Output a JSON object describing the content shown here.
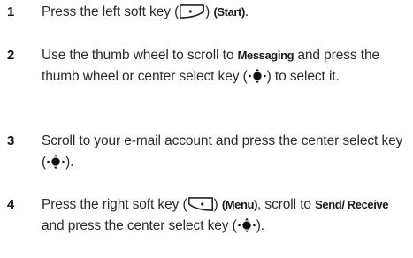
{
  "steps": [
    {
      "number": "1",
      "t1": "Press the left soft key (",
      "t2": ") ",
      "kw1": "(Start)",
      "t3": "."
    },
    {
      "number": "2",
      "t1": "Use the thumb wheel to scroll to ",
      "kw1": "Messaging",
      "t2": " and press the thumb wheel or center select key (",
      "t3": ") to select it."
    },
    {
      "number": "3",
      "t1": "Scroll to your e-mail account and press the center select key (",
      "t2": ")."
    },
    {
      "number": "4",
      "t1": "Press the right soft key (",
      "t2": ") ",
      "kw1": "(Menu)",
      "t3": ", scroll to ",
      "kw2": "Send/ Receive",
      "t4": " and press the center select key (",
      "t5": ")."
    }
  ],
  "icons": {
    "left_soft_key": "left-soft-key-icon",
    "right_soft_key": "right-soft-key-icon",
    "center_select_key": "center-select-key-icon"
  }
}
